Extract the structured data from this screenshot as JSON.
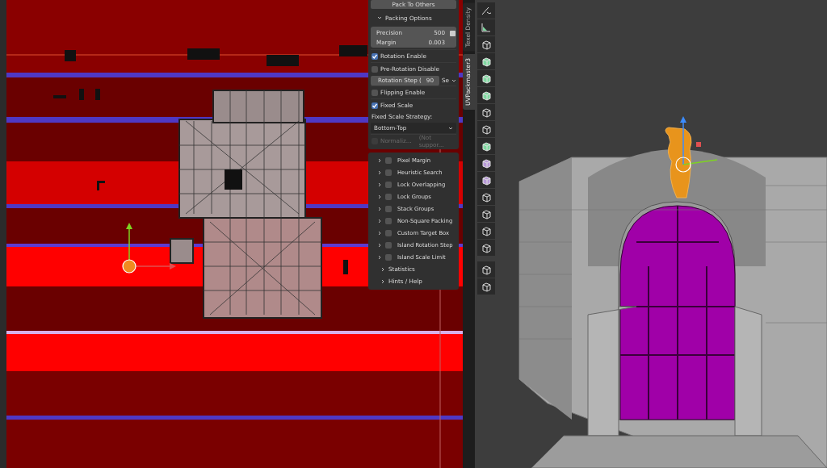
{
  "panel": {
    "items": [
      {
        "kind": "button",
        "label": "Pack To Others"
      },
      {
        "kind": "section",
        "label": "Packing Options",
        "expanded": true
      },
      {
        "kind": "fields",
        "fields": [
          {
            "label": "Precision",
            "value": "500"
          },
          {
            "label": "Margin",
            "value": "0.003"
          }
        ]
      },
      {
        "kind": "checkbox",
        "label": "Rotation Enable",
        "checked": true
      },
      {
        "kind": "checkbox",
        "label": "Pre-Rotation Disable",
        "checked": false
      },
      {
        "kind": "step",
        "label": "Rotation Step (",
        "value": "90",
        "unit": "Se"
      },
      {
        "kind": "checkbox",
        "label": "Flipping Enable",
        "checked": false
      },
      {
        "kind": "checkbox",
        "label": "Fixed Scale",
        "checked": true
      },
      {
        "kind": "caption",
        "label": "Fixed Scale Strategy:"
      },
      {
        "kind": "dropdown",
        "value": "Bottom-Top"
      },
      {
        "kind": "note_checkbox",
        "label": "Normaliz...",
        "note": "(Not suppor...",
        "checked": false,
        "disabled": true
      }
    ],
    "subpanels": [
      {
        "label": "Pixel Margin",
        "checked": false,
        "expanded": false
      },
      {
        "label": "Heuristic Search",
        "checked": false,
        "expanded": false
      },
      {
        "label": "Lock Overlapping",
        "checked": false,
        "expanded": false
      },
      {
        "label": "Lock Groups",
        "checked": false,
        "expanded": false
      },
      {
        "label": "Stack Groups",
        "checked": false,
        "expanded": false
      },
      {
        "label": "Non-Square Packing",
        "checked": false,
        "expanded": false
      },
      {
        "label": "Custom Target Box",
        "checked": false,
        "expanded": false
      },
      {
        "label": "Island Rotation Step",
        "checked": false,
        "expanded": false
      },
      {
        "label": "Island Scale Limit",
        "checked": false,
        "expanded": false
      }
    ],
    "sections": [
      {
        "label": "Statistics",
        "expanded": false
      },
      {
        "label": "Hints / Help",
        "expanded": false
      }
    ]
  },
  "sidebar_tabs": [
    {
      "label": "Texel Density",
      "selected": false
    },
    {
      "label": "UVPackmaster3",
      "selected": true
    }
  ]
}
